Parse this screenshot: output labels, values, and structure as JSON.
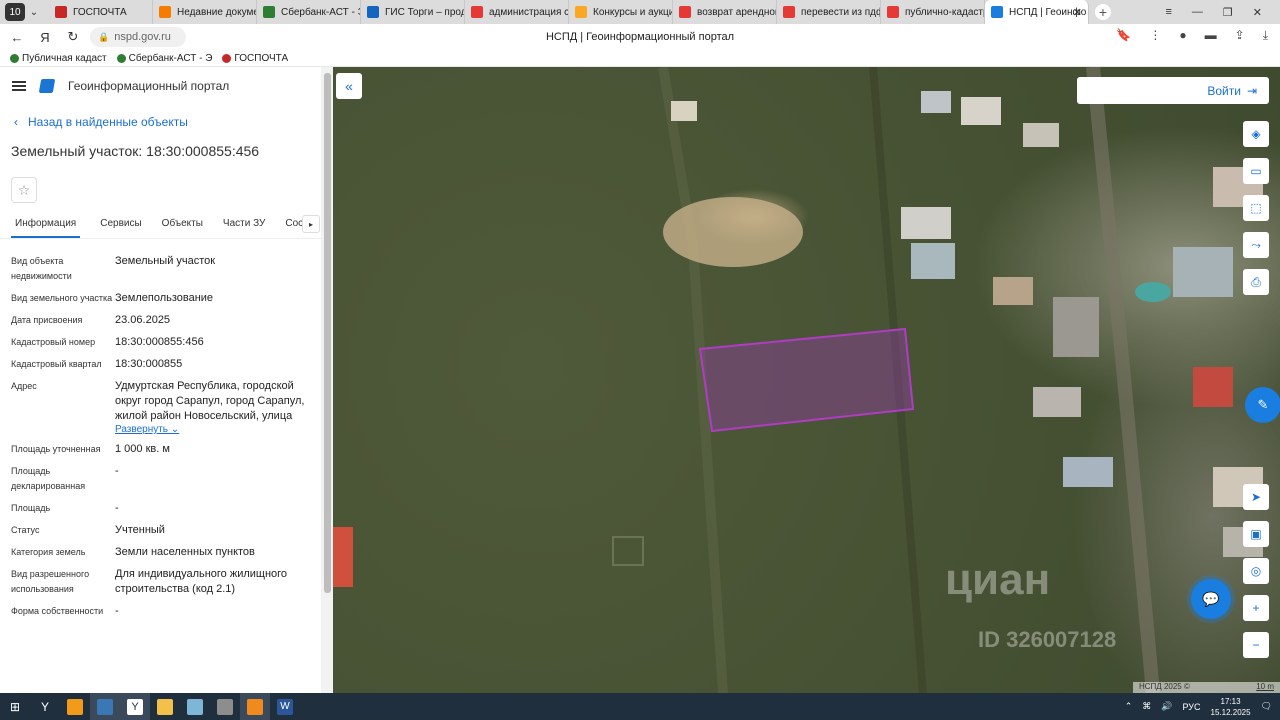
{
  "browser": {
    "tab_count": "10",
    "tabs": [
      {
        "label": "ГОСПОЧТА",
        "color": "#c62828"
      },
      {
        "label": "Недавние докумен",
        "color": "#f57c00"
      },
      {
        "label": "Сбербанк-АСТ - Эл",
        "color": "#2e7d32"
      },
      {
        "label": "ГИС Торги – прод",
        "color": "#1565c0"
      },
      {
        "label": "администрация са",
        "color": "#e53935"
      },
      {
        "label": "Конкурсы и аукцио",
        "color": "#f9a825"
      },
      {
        "label": "возврат арендной",
        "color": "#e53935"
      },
      {
        "label": "перевести из пдф",
        "color": "#e53935"
      },
      {
        "label": "публично-кадастр",
        "color": "#e53935"
      },
      {
        "label": "НСПД | Геоинфо",
        "color": "#1a7de0",
        "active": true
      }
    ],
    "url": "nspd.gov.ru",
    "page_title": "НСПД | Геоинформационный портал",
    "bookmarks": [
      {
        "label": "Публичная кадаст",
        "color": "#2e7d32"
      },
      {
        "label": "Сбербанк-АСТ - Э",
        "color": "#2e7d32"
      },
      {
        "label": "ГОСПОЧТА",
        "color": "#c62828"
      }
    ]
  },
  "panel": {
    "app_title": "Геоинформационный портал",
    "back_label": "Назад в найденные объекты",
    "object_title": "Земельный участок: 18:30:000855:456",
    "tabs": [
      "Информация",
      "Сервисы",
      "Объекты",
      "Части ЗУ",
      "Соста"
    ],
    "properties": [
      {
        "key": "Вид объекта недвижимости",
        "value": "Земельный участок"
      },
      {
        "key": "Вид земельного участка",
        "value": "Землепользование"
      },
      {
        "key": "Дата присвоения",
        "value": "23.06.2025"
      },
      {
        "key": "Кадастровый номер",
        "value": "18:30:000855:456"
      },
      {
        "key": "Кадастровый квартал",
        "value": "18:30:000855"
      },
      {
        "key": "Адрес",
        "value": "Удмуртская Республика, городской округ город Сарапул, город Сарапул, жилой район Новосельский, улица"
      },
      {
        "key": "Площадь уточненная",
        "value": "1 000 кв. м"
      },
      {
        "key": "Площадь декларированная",
        "value": "-"
      },
      {
        "key": "Площадь",
        "value": "-"
      },
      {
        "key": "Статус",
        "value": "Учтенный"
      },
      {
        "key": "Категория земель",
        "value": "Земли населенных пунктов"
      },
      {
        "key": "Вид разрешенного использования",
        "value": "Для индивидуального жилищного строительства (код 2.1)"
      },
      {
        "key": "Форма собственности",
        "value": "-"
      }
    ],
    "expand_label": "Развернуть"
  },
  "map": {
    "login_label": "Войти",
    "watermark": "циан",
    "watermark_id": "ID 326007128",
    "attribution": "НСПД 2025 ©",
    "scale": "10 m",
    "parcel_color": "#8e3fa0"
  },
  "taskbar": {
    "lang": "РУС",
    "time": "17:13",
    "date": "15.12.2025"
  }
}
